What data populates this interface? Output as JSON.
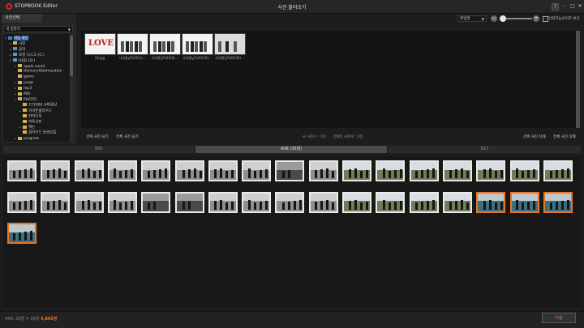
{
  "app": {
    "title": "STOPBOOK Editor",
    "window_title": "사진 불러오기",
    "help_label": "?",
    "minimize_label": "–",
    "maximize_label": "□",
    "close_label": "✕"
  },
  "left_panel": {
    "tab_label": "사진선택",
    "drive_value": "내 컴퓨터",
    "tree": [
      {
        "label": "바탕 화면",
        "level": 0,
        "icon": "desktop",
        "selected": true,
        "toggle": "▸"
      },
      {
        "label": "사진",
        "level": 1,
        "icon": "folder",
        "toggle": "▸"
      },
      {
        "label": "음악",
        "level": 1,
        "icon": "music",
        "toggle": "▸"
      },
      {
        "label": "로컬 디스크 (C:)",
        "level": 1,
        "icon": "drive",
        "toggle": "▸"
      },
      {
        "label": "HDD (D:)",
        "level": 1,
        "icon": "drive",
        "toggle": "▾"
      },
      {
        "label": "apple could",
        "level": 2,
        "icon": "folder",
        "toggle": "▸"
      },
      {
        "label": "DeliveryOptimization",
        "level": 2,
        "icon": "folder",
        "toggle": ""
      },
      {
        "label": "game",
        "level": 2,
        "icon": "folder",
        "toggle": ""
      },
      {
        "label": "jungs",
        "level": 2,
        "icon": "folder",
        "toggle": "▸"
      },
      {
        "label": "mp3",
        "level": 2,
        "icon": "folder",
        "toggle": "▸"
      },
      {
        "label": "MSI",
        "level": 2,
        "icon": "folder",
        "toggle": "▸"
      },
      {
        "label": "PHOTO",
        "level": 2,
        "icon": "folder",
        "toggle": "▾"
      },
      {
        "label": "171008 사파갈남",
        "level": 3,
        "icon": "folder",
        "toggle": ""
      },
      {
        "label": "아이폰클라우드",
        "level": 3,
        "icon": "folder",
        "toggle": "▸"
      },
      {
        "label": "카카오톡",
        "level": 3,
        "icon": "folder",
        "toggle": ""
      },
      {
        "label": "카톡사진",
        "level": 3,
        "icon": "folder",
        "toggle": ""
      },
      {
        "label": "캐논",
        "level": 3,
        "icon": "folder",
        "toggle": "▸"
      },
      {
        "label": "클라우드 동영상들",
        "level": 3,
        "icon": "folder",
        "toggle": ""
      },
      {
        "label": "program",
        "level": 2,
        "icon": "folder",
        "toggle": "▸"
      }
    ]
  },
  "toolbar": {
    "sort_value": "파일명",
    "zoom_minus": "−",
    "zoom_plus": "+",
    "zoom_level": 0.05,
    "print_only_label": "인화가능사이즈 보기"
  },
  "files": [
    {
      "name": "12.jpg",
      "kind": "love"
    },
    {
      "name": "사대결남%20(1)...",
      "kind": "group"
    },
    {
      "name": "사대결남%20(6)...",
      "kind": "group"
    },
    {
      "name": "사대결남%20(20)...",
      "kind": "group2"
    },
    {
      "name": "사대결남%20(30)...",
      "kind": "group3"
    }
  ],
  "actions": {
    "select_photos": "선택 사진 담기",
    "all_photos": "전체 사진 담기",
    "photo_count": "⊕ 사진수 : 0장",
    "selected_count": "선택된 사진수 : 0장",
    "delete_selected": "선택 사진 삭제",
    "delete_all": "전체 사진 삭제"
  },
  "size_tabs": [
    {
      "label": "3X5",
      "active": false
    },
    {
      "label": "4X6 (35장)",
      "active": true
    },
    {
      "label": "5X7",
      "active": false
    }
  ],
  "photos": {
    "rows": [
      [
        "hall",
        "hall",
        "hall",
        "hall",
        "hall",
        "hall",
        "hall",
        "hall",
        "suit",
        "hall",
        "outdoor",
        "outdoor",
        "outdoor",
        "outdoor",
        "outdoor",
        "outdoor",
        "outdoor"
      ],
      [
        "hall",
        "hall",
        "hall",
        "hall",
        "suit",
        "suit",
        "hall",
        "hall",
        "hall",
        "hall",
        "outdoor",
        "outdoor",
        "outdoor",
        "outdoor",
        "bus",
        "bus",
        "bus"
      ],
      [
        "bus"
      ]
    ],
    "selected": [
      [
        2,
        14
      ],
      [
        2,
        15
      ],
      [
        2,
        16
      ],
      [
        3,
        0
      ]
    ]
  },
  "status": {
    "summary": "4X6: 35장 = 35장",
    "price": "4,865원",
    "next_label": "다음"
  }
}
